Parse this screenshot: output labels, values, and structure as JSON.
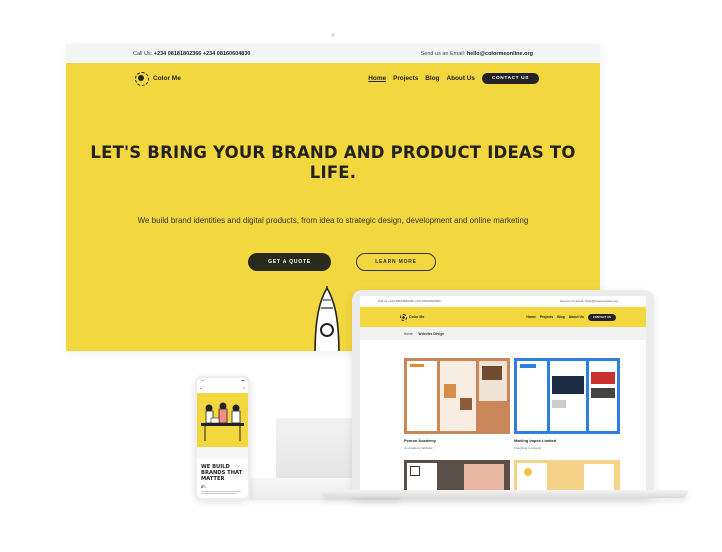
{
  "desktop": {
    "topbar": {
      "call_label": "Call Us:",
      "call_numbers": "+234 08181802366 +234 08160604830",
      "email_label": "Send us an Email:",
      "email": "hello@colormeonline.org"
    },
    "brand": "Color Me",
    "nav": [
      "Home",
      "Projects",
      "Blog",
      "About Us"
    ],
    "contact_button": "CONTACT US",
    "hero_title": "LET'S BRING YOUR BRAND AND PRODUCT IDEAS TO LIFE.",
    "hero_subtitle": "We build brand identities and digital products, from idea to strategic design, development and online marketing",
    "cta_primary": "GET A QUOTE",
    "cta_secondary": "LEARN MORE"
  },
  "laptop": {
    "topbar_left": "Call us +234 08181802366 +234 08160604830",
    "topbar_right": "Send us an Email: hello@colormeonline.org",
    "brand": "Color Me",
    "nav": [
      "Home",
      "Projects",
      "Blog",
      "About Us"
    ],
    "contact_button": "CONTACT US",
    "breadcrumb": [
      "Home",
      "Websites Design"
    ],
    "cards": [
      {
        "title": "Pemon Academy",
        "sub": "An Academy Website"
      },
      {
        "title": "Marling Impex Limited",
        "sub": "Freighting Company"
      }
    ]
  },
  "phone": {
    "title": "WE BUILD BRANDS THAT MATTER",
    "small_label": "ADOS"
  },
  "colors": {
    "brand_yellow": "#f3d73e",
    "dark": "#222222"
  }
}
